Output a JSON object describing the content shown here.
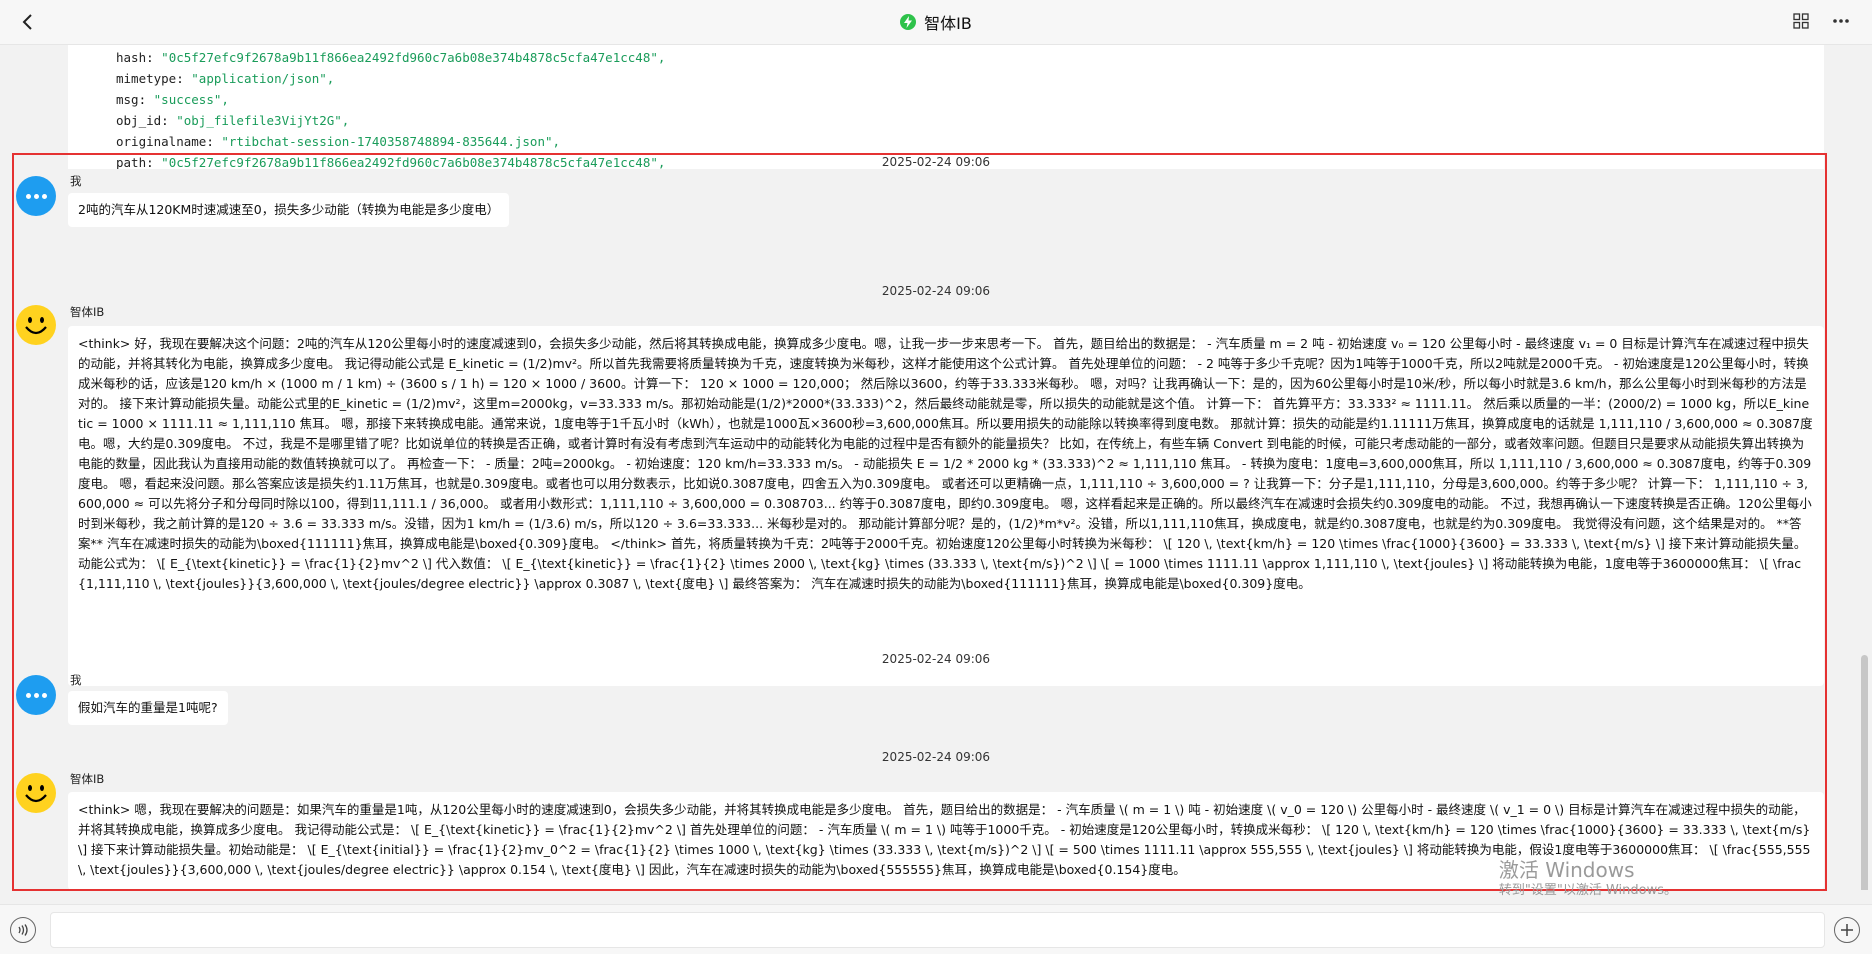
{
  "header": {
    "title": "智体IB",
    "back_icon": "chevron-left-icon",
    "grid_icon": "grid-icon",
    "more_icon": "more-dots-icon"
  },
  "json_snippet": {
    "lines": [
      {
        "key": "hash",
        "value": "\"0c5f27efc9f2678a9b11f866ea2492fd960c7a6b08e374b4878c5cfa47e1cc48\","
      },
      {
        "key": "mimetype",
        "value": "\"application/json\","
      },
      {
        "key": "msg",
        "value": "\"success\","
      },
      {
        "key": "obj_id",
        "value": "\"obj_filefile3VijYt2G\","
      },
      {
        "key": "originalname",
        "value": "\"rtibchat-session-1740358748894-835644.json\","
      },
      {
        "key": "path",
        "value": "\"0c5f27efc9f2678a9b11f866ea2492fd960c7a6b08e374b4878c5cfa47e1cc48\","
      }
    ]
  },
  "messages": [
    {
      "timestamp": "2025-02-24 09:06",
      "sender": "我",
      "role": "user",
      "text": "2吨的汽车从120KM时速减速至0，损失多少动能（转换为电能是多少度电）"
    },
    {
      "timestamp": "2025-02-24 09:06",
      "sender": "智体IB",
      "role": "bot",
      "text": "<think> 好，我现在要解决这个问题：2吨的汽车从120公里每小时的速度减速到0，会损失多少动能，然后将其转换成电能，换算成多少度电。嗯，让我一步一步来思考一下。 首先，题目给出的数据是： - 汽车质量 m = 2 吨 - 初始速度 v₀ = 120 公里每小时 - 最终速度 v₁ = 0 目标是计算汽车在减速过程中损失的动能，并将其转化为电能，换算成多少度电。 我记得动能公式是 E_kinetic = (1/2)mv²。所以首先我需要将质量转换为千克，速度转换为米每秒，这样才能使用这个公式计算。 首先处理单位的问题： - 2 吨等于多少千克呢？因为1吨等于1000千克，所以2吨就是2000千克。 - 初始速度是120公里每小时，转换成米每秒的话，应该是120 km/h × (1000 m / 1 km) ÷ (3600 s / 1 h) = 120 × 1000 / 3600。计算一下： 120 × 1000 = 120,000； 然后除以3600，约等于33.333米每秒。 嗯，对吗？让我再确认一下：是的，因为60公里每小时是10米/秒，所以每小时就是3.6 km/h，那么公里每小时到米每秒的方法是对的。 接下来计算动能损失量。动能公式里的E_kinetic = (1/2)mv²，这里m=2000kg，v=33.333 m/s。那初始动能是(1/2)*2000*(33.333)^2，然后最终动能就是零，所以损失的动能就是这个值。 计算一下： 首先算平方：33.333² ≈ 1111.11。 然后乘以质量的一半：(2000/2) = 1000 kg，所以E_kinetic = 1000 × 1111.11 ≈ 1,111,110 焦耳。 嗯，那接下来转换成电能。通常来说，1度电等于1千瓦小时（kWh），也就是1000瓦×3600秒=3,600,000焦耳。所以要用损失的动能除以转换率得到度电数。 那就计算：损失的动能是约1.11111万焦耳，换算成度电的话就是 1,111,110 / 3,600,000 ≈ 0.3087度电。嗯，大约是0.309度电。 不过，我是不是哪里错了呢？比如说单位的转换是否正确，或者计算时有没有考虑到汽车运动中的动能转化为电能的过程中是否有额外的能量损失？ 比如，在传统上，有些车辆 Convert 到电能的时候，可能只考虑动能的一部分，或者效率问题。但题目只是要求从动能损失算出转换为电能的数量，因此我认为直接用动能的数值转换就可以了。 再检查一下： - 质量：2吨=2000kg。 - 初始速度：120 km/h=33.333 m/s。 - 动能损失 E = 1/2 * 2000 kg * (33.333)^2 ≈ 1,111,110 焦耳。 - 转换为度电：1度电=3,600,000焦耳，所以 1,111,110 / 3,600,000 ≈ 0.3087度电，约等于0.309度电。 嗯，看起来没问题。那么答案应该是损失约1.11万焦耳，也就是0.309度电。或者也可以用分数表示，比如说0.3087度电，四舍五入为0.309度电。 或者还可以更精确一点，1,111,110 ÷ 3,600,000 = ? 让我算一下：分子是1,111,110，分母是3,600,000。约等于多少呢？ 计算一下： 1,111,110 ÷ 3,600,000 ≈ 可以先将分子和分母同时除以100，得到11,111.1 / 36,000。 或者用小数形式：1,111,110 ÷ 3,600,000 = 0.308703... 约等于0.3087度电，即约0.309度电。 嗯，这样看起来是正确的。所以最终汽车在减速时会损失约0.309度电的动能。 不过，我想再确认一下速度转换是否正确。120公里每小时到米每秒，我之前计算的是120 ÷ 3.6 = 33.333 m/s。没错，因为1 km/h = (1/3.6) m/s，所以120 ÷ 3.6=33.333... 米每秒是对的。 那动能计算部分呢？是的，(1/2)*m*v²。没错，所以1,111,110焦耳，换成度电，就是约0.3087度电，也就是约为0.309度电。 我觉得没有问题，这个结果是对的。 **答案** 汽车在减速时损失的动能为\\boxed{111111}焦耳，换算成电能是\\boxed{0.309}度电。 </think> 首先，将质量转换为千克：2吨等于2000千克。初始速度120公里每小时转换为米每秒： \\[ 120 \\, \\text{km/h} = 120 \\times \\frac{1000}{3600} = 33.333 \\, \\text{m/s} \\] 接下来计算动能损失量。动能公式为： \\[ E_{\\text{kinetic}} = \\frac{1}{2}mv^2 \\] 代入数值： \\[ E_{\\text{kinetic}} = \\frac{1}{2} \\times 2000 \\, \\text{kg} \\times (33.333 \\, \\text{m/s})^2 \\] \\[ = 1000 \\times 1111.11 \\approx 1,111,110 \\, \\text{joules} \\] 将动能转换为电能，1度电等于3600000焦耳： \\[ \\frac{1,111,110 \\, \\text{joules}}{3,600,000 \\, \\text{joules/degree electric}} \\approx 0.3087 \\, \\text{度电} \\] 最终答案为： 汽车在减速时损失的动能为\\boxed{111111}焦耳，换算成电能是\\boxed{0.309}度电。"
    },
    {
      "timestamp": "2025-02-24 09:06",
      "sender": "我",
      "role": "user",
      "text": "假如汽车的重量是1吨呢?"
    },
    {
      "timestamp": "2025-02-24 09:06",
      "sender": "智体IB",
      "role": "bot",
      "text": "<think> 嗯，我现在要解决的问题是：如果汽车的重量是1吨，从120公里每小时的速度减速到0，会损失多少动能，并将其转换成电能是多少度电。 首先，题目给出的数据是： - 汽车质量 \\( m = 1 \\) 吨 - 初始速度 \\( v_0 = 120 \\) 公里每小时 - 最终速度 \\( v_1 = 0 \\) 目标是计算汽车在减速过程中损失的动能，并将其转换成电能，换算成多少度电。 我记得动能公式是： \\[ E_{\\text{kinetic}} = \\frac{1}{2}mv^2 \\] 首先处理单位的问题： - 汽车质量 \\( m = 1 \\) 吨等于1000千克。 - 初始速度是120公里每小时，转换成米每秒： \\[ 120 \\, \\text{km/h} = 120 \\times \\frac{1000}{3600} = 33.333 \\, \\text{m/s} \\] 接下来计算动能损失量。初始动能是： \\[ E_{\\text{initial}} = \\frac{1}{2}mv_0^2 = \\frac{1}{2} \\times 1000 \\, \\text{kg} \\times (33.333 \\, \\text{m/s})^2 \\] \\[ = 500 \\times 1111.11 \\approx 555,555 \\, \\text{joules} \\] 将动能转换为电能，假设1度电等于3600000焦耳： \\[ \\frac{555,555 \\, \\text{joules}}{3,600,000 \\, \\text{joules/degree electric}} \\approx 0.154 \\, \\text{度电} \\] 因此，汽车在减速时损失的动能为\\boxed{555555}焦耳，换算成电能是\\boxed{0.154}度电。"
    }
  ],
  "watermark": {
    "line1": "激活 Windows",
    "line2": "转到\"设置\"以激活 Windows。"
  },
  "input": {
    "placeholder": "",
    "value": "",
    "voice_icon": "voice-icon",
    "add_icon": "add-circle-icon"
  }
}
